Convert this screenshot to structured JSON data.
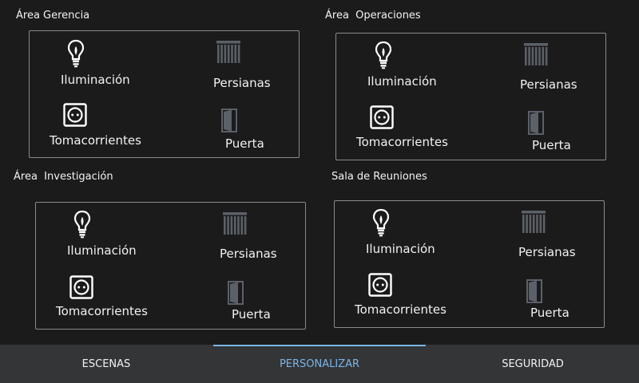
{
  "areas": [
    {
      "title": "Área Gerencia",
      "lighting": "Iluminación",
      "blinds": "Persianas",
      "outlets": "Tomacorrientes",
      "door": "Puerta"
    },
    {
      "title": "Área  Operaciones",
      "lighting": "Iluminación",
      "blinds": "Persianas",
      "outlets": "Tomacorrientes",
      "door": "Puerta"
    },
    {
      "title": "Área  Investigación",
      "lighting": "Iluminación",
      "blinds": "Persianas",
      "outlets": "Tomacorrientes",
      "door": "Puerta"
    },
    {
      "title": "Sala de Reuniones",
      "lighting": "Iluminación",
      "blinds": "Persianas",
      "outlets": "Tomacorrientes",
      "door": "Puerta"
    }
  ],
  "tabs": [
    {
      "label": "ESCENAS",
      "active": false
    },
    {
      "label": "PERSONALIZAR",
      "active": true
    },
    {
      "label": "SEGURIDAD",
      "active": false
    }
  ],
  "colors": {
    "background": "#1b1b1c",
    "accent": "#7ab5e6",
    "tabbar": "#343537",
    "muted_icon": "#5c6068"
  },
  "icons": {
    "lighting": "lightbulb-icon",
    "blinds": "blinds-icon",
    "outlets": "power-outlet-icon",
    "door": "door-icon"
  }
}
